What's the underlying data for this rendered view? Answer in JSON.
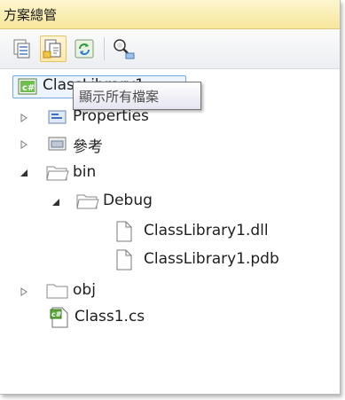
{
  "window": {
    "title": "方案總管"
  },
  "toolbar": {
    "buttons": [
      {
        "icon": "properties-icon"
      },
      {
        "icon": "show-all-files-icon"
      },
      {
        "icon": "refresh-icon"
      },
      {
        "icon": "view-class-diagram-icon"
      }
    ],
    "tooltip": "顯示所有檔案"
  },
  "tree": {
    "project": {
      "label": "ClassLibrary1"
    },
    "items": [
      {
        "label": "Properties",
        "expanded": false
      },
      {
        "label": "參考",
        "expanded": false
      },
      {
        "label": "bin",
        "expanded": true
      },
      {
        "label": "Debug",
        "expanded": true
      },
      {
        "label": "ClassLibrary1.dll"
      },
      {
        "label": "ClassLibrary1.pdb"
      },
      {
        "label": "obj",
        "expanded": false
      },
      {
        "label": "Class1.cs"
      }
    ]
  },
  "colors": {
    "title_bar": "#f7e79a",
    "selection": "#7aa7e2",
    "tooltip_border": "#767676"
  }
}
